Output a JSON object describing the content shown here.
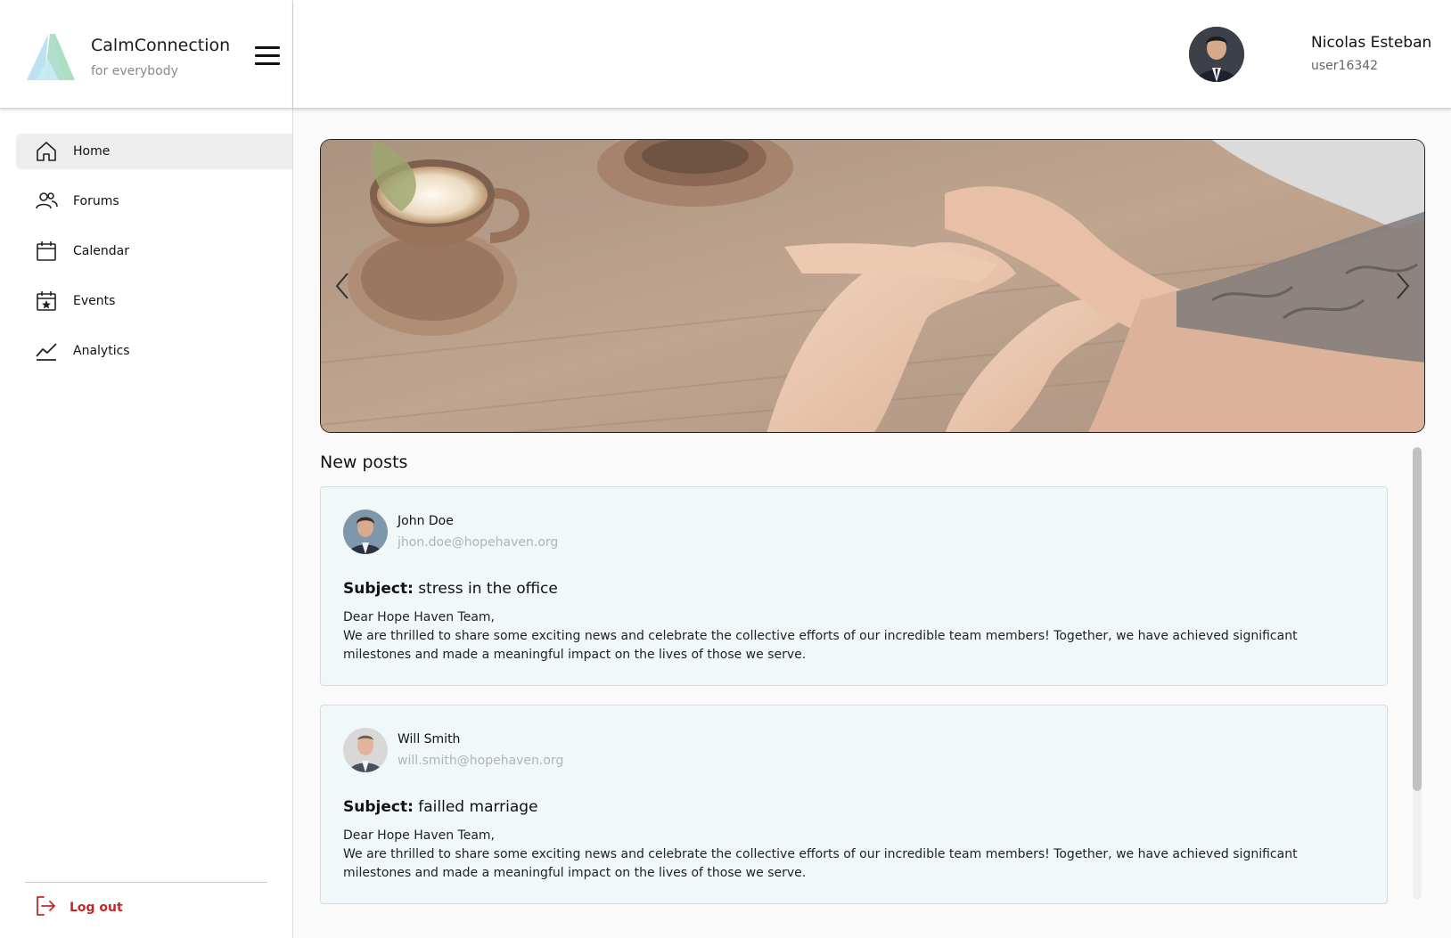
{
  "brand": {
    "name": "CalmConnection",
    "tagline": "for everybody"
  },
  "nav": {
    "items": [
      {
        "label": "Home",
        "icon": "home-icon",
        "active": true
      },
      {
        "label": "Forums",
        "icon": "users-icon",
        "active": false
      },
      {
        "label": "Calendar",
        "icon": "calendar-icon",
        "active": false
      },
      {
        "label": "Events",
        "icon": "event-star-icon",
        "active": false
      },
      {
        "label": "Analytics",
        "icon": "chart-line-icon",
        "active": false
      }
    ],
    "logout_label": "Log out"
  },
  "user": {
    "name": "Nicolas Esteban",
    "handle": "user16342"
  },
  "main": {
    "section_title": "New posts",
    "posts": [
      {
        "author": "John Doe",
        "email": "jhon.doe@hopehaven.org",
        "subject_label": "Subject:",
        "subject": "stress in the office",
        "greeting": "Dear Hope Haven Team,",
        "body": "We are thrilled to share some exciting news and celebrate the collective efforts of our incredible team members! Together, we have achieved significant milestones and made a meaningful impact on the lives of those we serve."
      },
      {
        "author": "Will Smith",
        "email": "will.smith@hopehaven.org",
        "subject_label": "Subject:",
        "subject": "failled marriage",
        "greeting": "Dear Hope Haven Team,",
        "body": "We are thrilled to share some exciting news and celebrate the collective efforts of our incredible team members! Together, we have achieved significant milestones and made a meaningful impact on the lives of those we serve."
      }
    ]
  },
  "colors": {
    "logout": "#c62828",
    "post_background": "#f1f8f9",
    "logo_blue": "#a9d6ea",
    "logo_green": "#9ed9b4"
  }
}
